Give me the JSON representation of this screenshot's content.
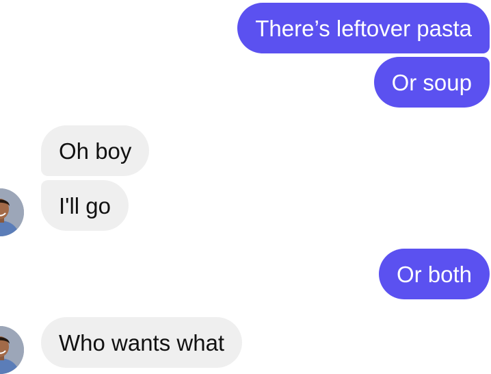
{
  "colors": {
    "outgoing_bubble": "#5b51f0",
    "incoming_bubble": "#efefef",
    "outgoing_text": "#ffffff",
    "incoming_text": "#111111"
  },
  "messages": [
    {
      "direction": "outgoing",
      "text": "There’s leftover pasta"
    },
    {
      "direction": "outgoing",
      "text": "Or soup"
    },
    {
      "direction": "incoming",
      "text": "Oh boy"
    },
    {
      "direction": "incoming",
      "text": "I'll go"
    },
    {
      "direction": "outgoing",
      "text": "Or both"
    },
    {
      "direction": "incoming",
      "text": "Who wants what"
    }
  ],
  "avatar_icon": "person-photo-icon"
}
